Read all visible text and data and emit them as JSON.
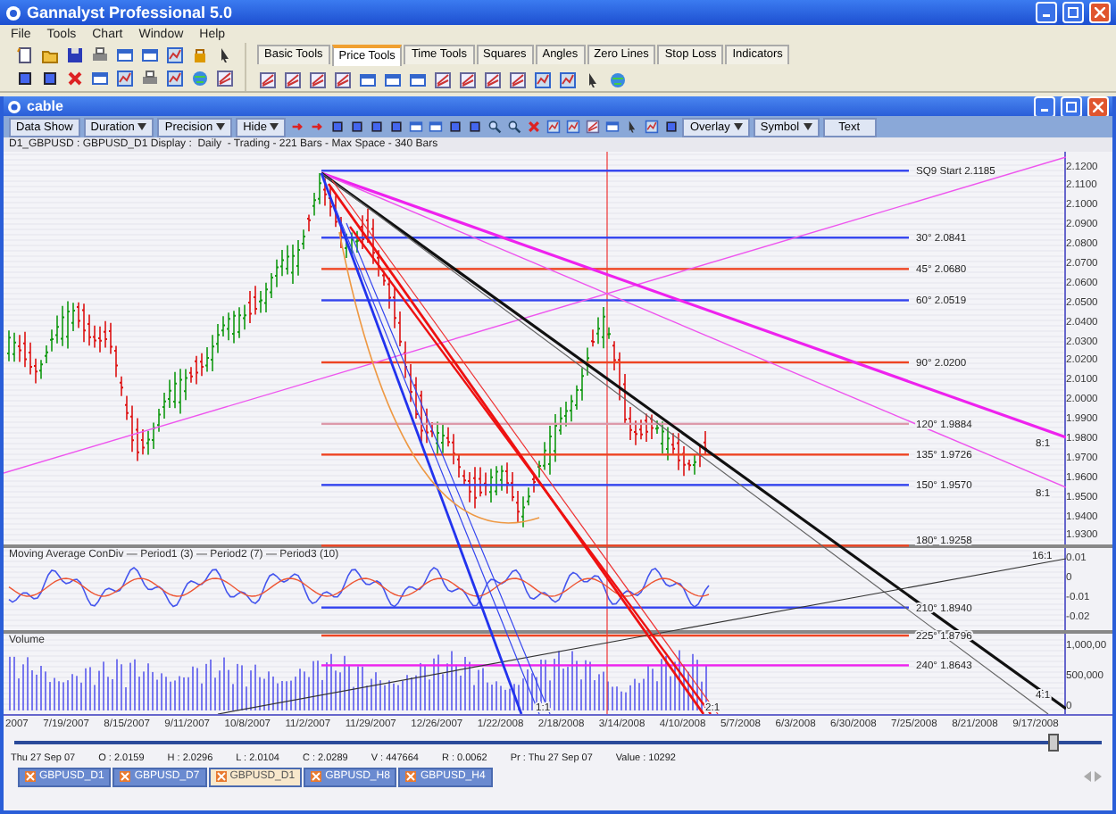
{
  "window": {
    "title": "Gannalyst Professional 5.0"
  },
  "menu": [
    "File",
    "Tools",
    "Chart",
    "Window",
    "Help"
  ],
  "tool_tabs": [
    {
      "label": "Basic Tools",
      "selected": false
    },
    {
      "label": "Price Tools",
      "selected": true
    },
    {
      "label": "Time Tools",
      "selected": false
    },
    {
      "label": "Squares",
      "selected": false
    },
    {
      "label": "Angles",
      "selected": false
    },
    {
      "label": "Zero Lines",
      "selected": false
    },
    {
      "label": "Stop Loss",
      "selected": false
    },
    {
      "label": "Indicators",
      "selected": false
    }
  ],
  "chart_window": {
    "title": "cable",
    "toolbar": [
      {
        "label": "Data Show",
        "kind": "button"
      },
      {
        "label": "Duration",
        "kind": "dropdown"
      },
      {
        "label": "Precision",
        "kind": "dropdown"
      },
      {
        "label": "Hide",
        "kind": "dropdown"
      },
      {
        "label": "Overlay",
        "kind": "dropdown"
      },
      {
        "label": "Symbol",
        "kind": "dropdown"
      },
      {
        "label": "Text",
        "kind": "button"
      }
    ],
    "info": "D1_GBPUSD : GBPUSD_D1 Display :  Daily  - Trading - 221 Bars - Max Space - 340 Bars",
    "price_axis": [
      "2.1200",
      "2.1100",
      "2.1000",
      "2.0900",
      "2.0800",
      "2.0700",
      "2.0600",
      "2.0500",
      "2.0400",
      "2.0300",
      "2.0200",
      "2.0100",
      "2.0000",
      "1.9900",
      "1.9800",
      "1.9700",
      "1.9600",
      "1.9500",
      "1.9400",
      "1.9300"
    ],
    "levels": [
      {
        "label": "SQ9 Start 2.1185",
        "color": "#3344ee"
      },
      {
        "label": "30° 2.0841",
        "color": "#3344ee"
      },
      {
        "label": "45° 2.0680",
        "color": "#ee4422"
      },
      {
        "label": "60° 2.0519",
        "color": "#3344ee"
      },
      {
        "label": "90° 2.0200",
        "color": "#ee4422"
      },
      {
        "label": "120° 1.9884",
        "color": "#dd99aa"
      },
      {
        "label": "135° 1.9726",
        "color": "#ee4422"
      },
      {
        "label": "150° 1.9570",
        "color": "#3344ee"
      },
      {
        "label": "180° 1.9258",
        "color": "#ee4422"
      },
      {
        "label": "210° 1.8940",
        "color": "#3344ee"
      },
      {
        "label": "225° 1.8796",
        "color": "#ee4422"
      },
      {
        "label": "240° 1.8643",
        "color": "#ee22ee"
      }
    ],
    "ratio_labels": [
      "8:1",
      "8:1",
      "16:1",
      "1:1",
      "2:1",
      "4:1"
    ],
    "macd": {
      "title": "Moving Average ConDiv — Period1 (3) — Period2 (7) — Period3 (10)",
      "axis": [
        "0.01",
        "0",
        "-0.01",
        "-0.02"
      ]
    },
    "volume": {
      "title": "Volume",
      "axis": [
        "1,000,00",
        "500,000",
        "0"
      ]
    },
    "dates": [
      "2007",
      "7/19/2007",
      "8/15/2007",
      "9/11/2007",
      "10/8/2007",
      "11/2/2007",
      "11/29/2007",
      "12/26/2007",
      "1/22/2008",
      "2/18/2008",
      "3/14/2008",
      "4/10/2008",
      "5/7/2008",
      "6/3/2008",
      "6/30/2008",
      "7/25/2008",
      "8/21/2008",
      "9/17/2008"
    ],
    "slider": {
      "level": 0.955
    },
    "status": [
      "Thu 27 Sep 07",
      "O : 2.0159",
      "H : 2.0296",
      "L : 2.0104",
      "C : 2.0289",
      "V : 447664",
      "R : 0.0062",
      "Pr : Thu 27 Sep 07",
      "Value : 10292"
    ],
    "tabs": [
      {
        "label": "GBPUSD_D1",
        "selected": false
      },
      {
        "label": "GBPUSD_D7",
        "selected": false
      },
      {
        "label": "GBPUSD_D1",
        "selected": true
      },
      {
        "label": "GBPUSD_H8",
        "selected": false
      },
      {
        "label": "GBPUSD_H4",
        "selected": false
      }
    ]
  }
}
